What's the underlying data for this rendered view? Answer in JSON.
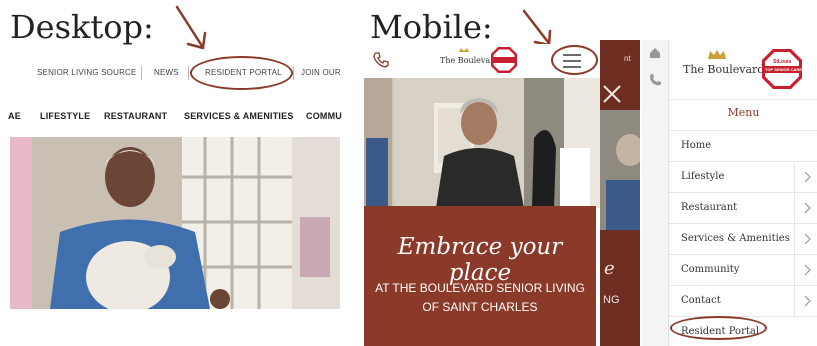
{
  "labels": {
    "desktop": "Desktop:",
    "mobile": "Mobile:"
  },
  "desktop": {
    "top_nav": [
      "SENIOR LIVING SOURCE",
      "NEWS",
      "RESIDENT PORTAL",
      "JOIN OUR"
    ],
    "main_nav": [
      "AE",
      "LIFESTYLE",
      "RESTAURANT",
      "SERVICES & AMENITIES",
      "COMMU"
    ]
  },
  "mobile": {
    "logo_text": "The Boulevard",
    "badge_top": "StLouis",
    "badge_main": "TOP SENIOR CARE",
    "banner_script": "Embrace your place",
    "banner_sub_line1": "AT THE BOULEVARD SENIOR LIVING",
    "banner_sub_line2": "OF SAINT CHARLES",
    "side_fragment_1": "nt",
    "side_fragment_2": "e",
    "side_fragment_3": "NG",
    "menu": {
      "title": "Menu",
      "items": [
        {
          "label": "Home",
          "chevron": false
        },
        {
          "label": "Lifestyle",
          "chevron": true
        },
        {
          "label": "Restaurant",
          "chevron": true
        },
        {
          "label": "Services & Amenities",
          "chevron": true
        },
        {
          "label": "Community",
          "chevron": true
        },
        {
          "label": "Contact",
          "chevron": true
        },
        {
          "label": "Resident Portal",
          "chevron": false
        }
      ]
    }
  },
  "colors": {
    "accent": "#8b3a2a",
    "dark": "#6e2e22",
    "badge": "#c8202e",
    "gold": "#c9a23a"
  }
}
